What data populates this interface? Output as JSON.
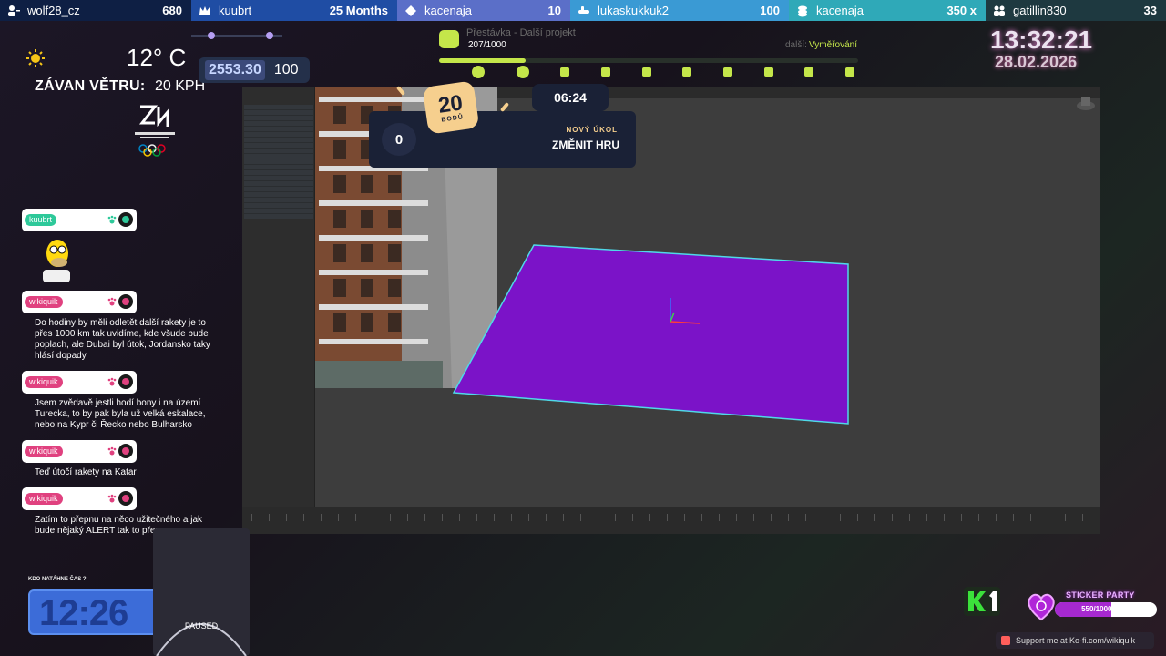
{
  "topbar": {
    "items": [
      {
        "user": "wolf28_cz",
        "value": "680",
        "icon": "user-group-icon"
      },
      {
        "user": "kuubrt",
        "value": "25 Months",
        "icon": "crown-icon"
      },
      {
        "user": "kacenaja",
        "value": "10",
        "icon": "diamond-icon"
      },
      {
        "user": "lukaskukkuk2",
        "value": "100",
        "icon": "bits-hand-icon"
      },
      {
        "user": "kacenaja",
        "value": "350 x",
        "icon": "coin-stack-icon"
      },
      {
        "user": "gatillin830",
        "value": "33",
        "icon": "users-icon"
      }
    ]
  },
  "weather": {
    "temperature": "12° C",
    "wind_label": "ZÁVAN VĚTRU:",
    "wind_value": "20 KPH",
    "icon": "sun-icon"
  },
  "counter": {
    "current": "2553.30",
    "max": "100"
  },
  "clock": {
    "time": "13:32:21",
    "date": "28.02.2026"
  },
  "project": {
    "title": "Přestávka - Další projekt",
    "progress_text": "207/1000",
    "progress_value": 207,
    "progress_max": 1000,
    "next_label": "další:",
    "next_value": "Vyměřování"
  },
  "task": {
    "points": "20",
    "points_unit": "BODŮ",
    "timer": "06:24",
    "score": "0",
    "new_task_label": "NOVÝ ÚKOL",
    "action": "ZMĚNIT HRU"
  },
  "chat": {
    "messages": [
      {
        "user": "kuubrt",
        "color": "#2ec99a",
        "dot": "#2ec99a",
        "text": ""
      },
      {
        "user": "wikiquik",
        "color": "#e0417f",
        "dot": "#e0417f",
        "text": "Do hodiny by měli odletět další rakety je to přes 1000 km tak uvidíme, kde všude bude poplach, ale Dubai byl útok, Jordansko taky hlásí dopady"
      },
      {
        "user": "wikiquik",
        "color": "#e0417f",
        "dot": "#e0417f",
        "text": "Jsem zvědavě jestli hodí bony i na území Turecka, to by pak byla už velká eskalace, nebo na Kypr či Řecko nebo Bulharsko"
      },
      {
        "user": "wikiquik",
        "color": "#e0417f",
        "dot": "#e0417f",
        "text": "Teď útočí rakety na Katar"
      },
      {
        "user": "wikiquik",
        "color": "#e0417f",
        "dot": "#e0417f",
        "text": "Zatím to přepnu na něco užitečného a jak bude nějaký ALERT tak to přepnu"
      }
    ]
  },
  "race": {
    "label": "KDO NATÁHNE ČAS ?",
    "time": "12:26"
  },
  "media": {
    "status": "PAUSED"
  },
  "sticker": {
    "title": "STICKER PARTY",
    "progress_text": "550/1000 BITS",
    "value": 550,
    "max": 1000
  },
  "kofi": {
    "text": "Support me at Ko-fi.com/wikiquik"
  },
  "colors": {
    "accent": "#c4e64a",
    "plane": "#7b13c8",
    "plane_edge": "#4fd9e8"
  }
}
